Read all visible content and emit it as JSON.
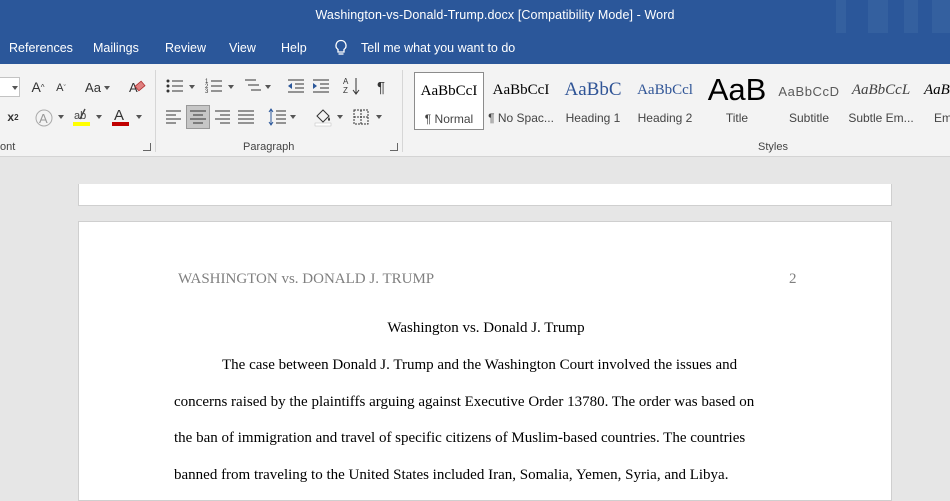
{
  "window": {
    "title": "Washington-vs-Donald-Trump.docx [Compatibility Mode]  -  Word"
  },
  "menu": {
    "tabs": [
      "References",
      "Mailings",
      "Review",
      "View",
      "Help"
    ],
    "tell_me": "Tell me what you want to do"
  },
  "ribbon": {
    "groups": {
      "font": "ont",
      "paragraph": "Paragraph",
      "styles": "Styles"
    },
    "styles": [
      {
        "sample": "AaBbCcI",
        "name": "¶ Normal",
        "selected": true
      },
      {
        "sample": "AaBbCcI",
        "name": "¶ No Spac...",
        "selected": false
      },
      {
        "sample": "AaBbC",
        "name": "Heading 1",
        "selected": false
      },
      {
        "sample": "AaBbCcl",
        "name": "Heading 2",
        "selected": false
      },
      {
        "sample": "AaB",
        "name": "Title",
        "selected": false
      },
      {
        "sample": "AaBbCcD",
        "name": "Subtitle",
        "selected": false
      },
      {
        "sample": "AaBbCcL",
        "name": "Subtle Em...",
        "selected": false
      },
      {
        "sample": "AaB",
        "name": "Emp",
        "selected": false
      }
    ]
  },
  "document": {
    "header": "WASHINGTON vs. DONALD J. TRUMP",
    "page_number": "2",
    "heading": "Washington vs. Donald J. Trump",
    "lines": [
      "The case between Donald J. Trump and the Washington Court involved the issues and",
      "concerns raised by the plaintiffs arguing against Executive Order 13780. The order was based on",
      "the ban of immigration and travel of specific citizens of Muslim-based countries. The countries",
      "banned from traveling to the United States included Iran, Somalia, Yemen, Syria, and Libya."
    ]
  },
  "colors": {
    "titlebar": "#2b579a",
    "ribbon": "#f3f3f3",
    "font_color_bar": "#c00000",
    "highlight_bar": "#ffff00"
  }
}
